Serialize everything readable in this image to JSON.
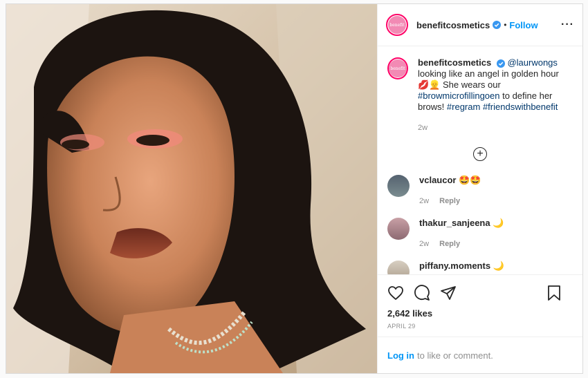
{
  "post": {
    "username": "benefitcosmetics",
    "avatar_text": "benefit",
    "follow_label": "Follow",
    "more_icon": "more-horizontal-icon",
    "caption": {
      "username": "benefitcosmetics",
      "mention": "@laurwongs",
      "text_1": "looking like an angel in golden hour",
      "emojis": "💋👱",
      "text_2": " She wears our ",
      "hashtag_1": "#browmicrofillingoen",
      "text_3": " to define her brows! ",
      "hashtag_2": "#regram",
      "hashtag_3": "#friendswithbenefit",
      "time": "2w"
    },
    "load_more_symbol": "+",
    "comments": [
      {
        "username": "vclaucor",
        "text": "🤩🤩",
        "time": "2w",
        "reply": "Reply"
      },
      {
        "username": "thakur_sanjeena",
        "text": "🌙",
        "time": "2w",
        "reply": "Reply"
      },
      {
        "username": "piffany.moments",
        "text": "🌙"
      }
    ],
    "likes": "2,642 likes",
    "date": "APRIL 29",
    "login_link": "Log in",
    "login_text": "to like or comment."
  },
  "colors": {
    "accent": "#0095f6",
    "verified": "#3897f0",
    "text": "#262626",
    "muted": "#8e8e8e"
  }
}
